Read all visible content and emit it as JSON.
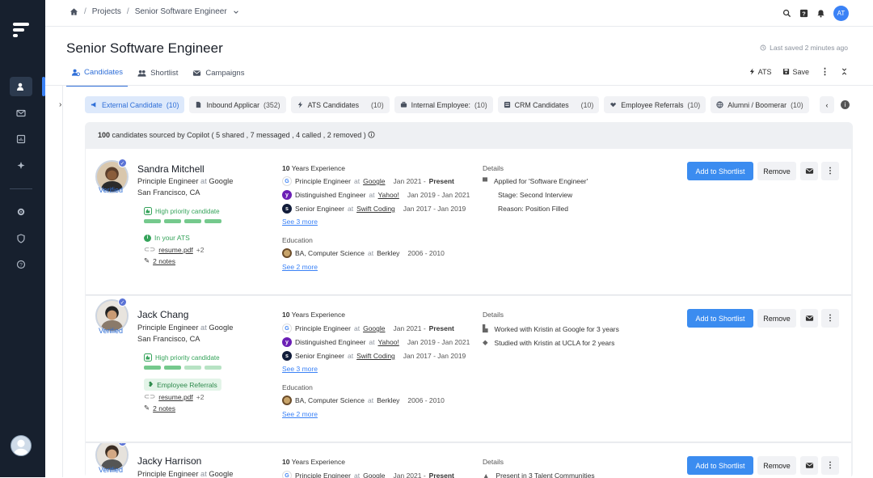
{
  "breadcrumb": {
    "home_icon": "home-icon",
    "projects": "Projects",
    "current": "Senior Software Engineer"
  },
  "user": {
    "initials": "AT"
  },
  "page": {
    "title": "Senior Software Engineer",
    "last_saved": "Last saved 2 minutes ago"
  },
  "tabs": [
    {
      "label": "Candidates",
      "icon": "users-icon"
    },
    {
      "label": "Shortlist",
      "icon": "people-icon"
    },
    {
      "label": "Campaigns",
      "icon": "mail-icon"
    }
  ],
  "actions": {
    "ats": "ATS",
    "save": "Save"
  },
  "filters": [
    {
      "label": "External Candidate",
      "count": "(10)"
    },
    {
      "label": "Inbound Applicar",
      "count": "(352)"
    },
    {
      "label": "ATS Candidates",
      "count": "(10)"
    },
    {
      "label": "Internal Employee:",
      "count": "(10)"
    },
    {
      "label": "CRM Candidates",
      "count": "(10)"
    },
    {
      "label": "Employee Referrals",
      "count": "(10)"
    },
    {
      "label": "Alumni / Boomerar",
      "count": "(10)"
    }
  ],
  "summary": {
    "count": "100",
    "text": "candidates sourced by Copilot ( 5 shared , 7 messaged , 4 called , 2 removed )"
  },
  "labels": {
    "verified": "Verified",
    "experience_suffix": "Years Experience",
    "education": "Education",
    "details": "Details",
    "add": "Add to Shortlist",
    "remove": "Remove",
    "at": "at",
    "high_priority": "High priority candidate",
    "see_3_more": "See 3 more",
    "see_2_more": "See 2 more",
    "resume": "resume.pdf",
    "resume_more": "+2",
    "notes": "2 notes"
  },
  "candidates": [
    {
      "name": "Sandra Mitchell",
      "role": "Principle Engineer",
      "company": "Google",
      "location": "San Francisco, CA",
      "tag": "In your ATS",
      "years": "10",
      "experience": [
        {
          "title": "Principle Engineer",
          "company": "Google",
          "dates": "Jan 2021 - ",
          "present": "Present"
        },
        {
          "title": "Distinguished Engineer",
          "company": "Yahoo!",
          "dates": "Jan 2019 - Jan 2021",
          "present": ""
        },
        {
          "title": "Senior Engineer",
          "company": "Swift Coding",
          "dates": "Jan 2017 - Jan 2019",
          "present": ""
        }
      ],
      "education": {
        "degree": "BA, Computer Science",
        "school": "Berkley",
        "dates": "2006 - 2010"
      },
      "details": [
        "Applied for 'Software Engineer'",
        "Stage: Second Interview",
        "Reason: Position Filled"
      ]
    },
    {
      "name": "Jack Chang",
      "role": "Principle Engineer",
      "company": "Google",
      "location": "San Francisco, CA",
      "tag": "Employee Referrals",
      "years": "10",
      "experience": [
        {
          "title": "Principle Engineer",
          "company": "Google",
          "dates": "Jan 2021 - ",
          "present": "Present"
        },
        {
          "title": "Distinguished Engineer",
          "company": "Yahoo!",
          "dates": "Jan 2019 - Jan 2021",
          "present": ""
        },
        {
          "title": "Senior Engineer",
          "company": "Swift Coding",
          "dates": "Jan 2017 - Jan 2019",
          "present": ""
        }
      ],
      "education": {
        "degree": "BA, Computer Science",
        "school": "Berkley",
        "dates": "2006 - 2010"
      },
      "details": [
        "Worked with Kristin at Google for 3 years",
        "Studied with Kristin at UCLA for 2 years"
      ]
    },
    {
      "name": "Jacky Harrison",
      "role": "Principle Engineer",
      "company": "Google",
      "years": "10",
      "experience": [
        {
          "title": "Principle Engineer",
          "company": "Google",
          "dates": "Jan 2021 - ",
          "present": "Present"
        }
      ],
      "details": [
        "Present in 3 Talent Communities"
      ]
    }
  ]
}
